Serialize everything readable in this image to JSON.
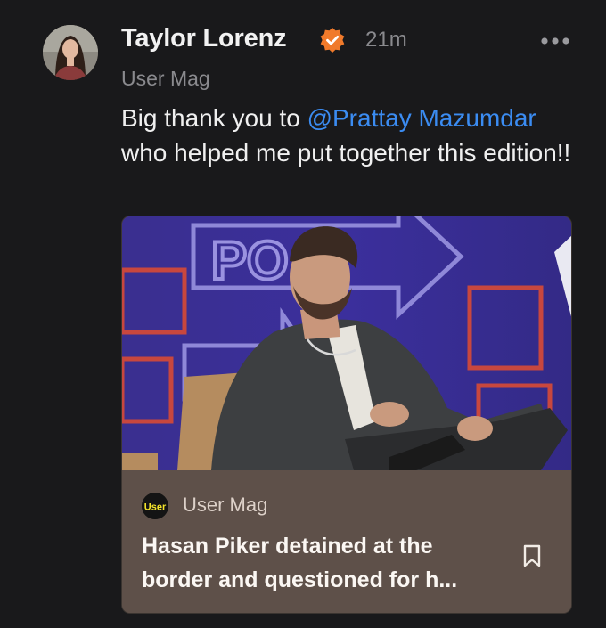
{
  "post": {
    "author": "Taylor Lorenz",
    "timestamp": "21m",
    "publication": "User Mag",
    "body": {
      "prefix": "Big thank you to ",
      "mention": "@Prattay Mazumdar",
      "suffix": " who helped me put together this edition!!"
    }
  },
  "card": {
    "publication": "User Mag",
    "logo_text": "User",
    "headline": "Hasan Piker detained at the border and questioned for h..."
  },
  "icons": {
    "verified": "verified-badge-icon",
    "more": "more-horizontal-icon",
    "bookmark": "bookmark-icon"
  },
  "colors": {
    "background": "#19191b",
    "mention": "#3b8cf2",
    "verified": "#f07a2b",
    "card_footer": "#5e5049",
    "muted_text": "#8a8a8e"
  }
}
